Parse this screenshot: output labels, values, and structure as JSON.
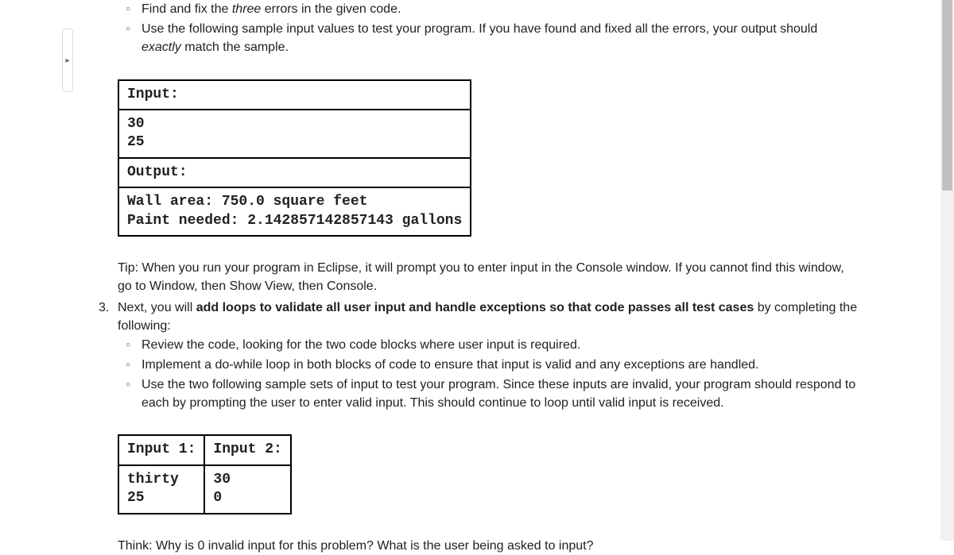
{
  "bullets_top": [
    {
      "pre": "Find and fix the ",
      "italic": "three",
      "post": " errors in the given code."
    },
    {
      "pre": "Use the following sample input values to test your program. If you have found and fixed all the errors, your output should ",
      "italic": "exactly",
      "post": " match the sample."
    }
  ],
  "table1": {
    "input_label": "Input:",
    "input_val": "30\n25",
    "output_label": "Output:",
    "output_val": "Wall area: 750.0 square feet\nPaint needed: 2.142857142857143 gallons"
  },
  "tip_text": "Tip: When you run your program in Eclipse, it will prompt you to enter input in the Console window. If you cannot find this window, go to Window, then Show View, then Console.",
  "step3": {
    "number": "3.",
    "pre": "Next, you will ",
    "bold": "add loops to validate all user input and handle exceptions so that code passes all test cases",
    "post": " by completing the following:"
  },
  "bullets_step3": [
    "Review the code, looking for the two code blocks where user input is required.",
    "Implement a do-while loop in both blocks of code to ensure that input is valid and any exceptions are handled.",
    "Use the two following sample sets of input to test your program. Since these inputs are invalid, your program should respond to each by prompting the user to enter valid input. This should continue to loop until valid input is received."
  ],
  "table2": {
    "h1": "Input 1:",
    "h2": "Input 2:",
    "c1": "thirty\n25",
    "c2": "30\n0"
  },
  "think_text": "Think: Why is 0 invalid input for this problem? What is the user being asked to input?"
}
